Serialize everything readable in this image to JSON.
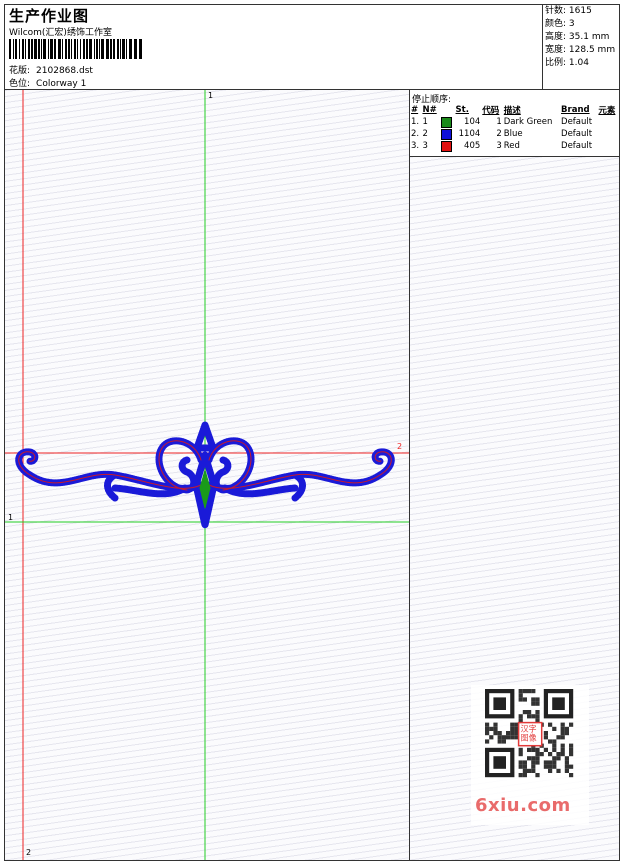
{
  "header": {
    "title": "生产作业图",
    "company": "Wilcom(汇宏)绣饰工作室",
    "design_label": "花版:",
    "design_file": "2102868.dst",
    "colorway_label": "色位:",
    "colorway": "Colorway 1"
  },
  "stats": [
    {
      "label": "针数:",
      "value": "1615"
    },
    {
      "label": "颜色:",
      "value": "3"
    },
    {
      "label": "高度:",
      "value": "35.1 mm"
    },
    {
      "label": "宽度:",
      "value": "128.5 mm"
    },
    {
      "label": "比例:",
      "value": "1.04"
    }
  ],
  "stop_sequence": {
    "title": "停止顺序:",
    "columns": [
      "#",
      "N#",
      "St.",
      "代码",
      "描述",
      "Brand",
      "元素"
    ],
    "rows": [
      {
        "idx": "1.",
        "n": "1",
        "color": "#1a8a1a",
        "stitches": "104",
        "code": "1",
        "desc": "Dark Green",
        "brand": "Default"
      },
      {
        "idx": "2.",
        "n": "2",
        "color": "#1010d8",
        "stitches": "1104",
        "code": "2",
        "desc": "Blue",
        "brand": "Default"
      },
      {
        "idx": "3.",
        "n": "3",
        "color": "#e01010",
        "stitches": "405",
        "code": "3",
        "desc": "Red",
        "brand": "Default"
      }
    ]
  },
  "axes": {
    "top_marker": "1",
    "left_marker": "1",
    "bottom_marker": "2",
    "right_marker": "2"
  },
  "watermark": {
    "stamp_line1": "汉字",
    "stamp_line2": "图像",
    "site": "6xiu.com"
  },
  "colors": {
    "guide_green": "#22cc22",
    "guide_red": "#ee2222",
    "thread_blue": "#1a1ad8",
    "thread_red": "#d81a1a",
    "thread_green": "#1a9a1a"
  }
}
